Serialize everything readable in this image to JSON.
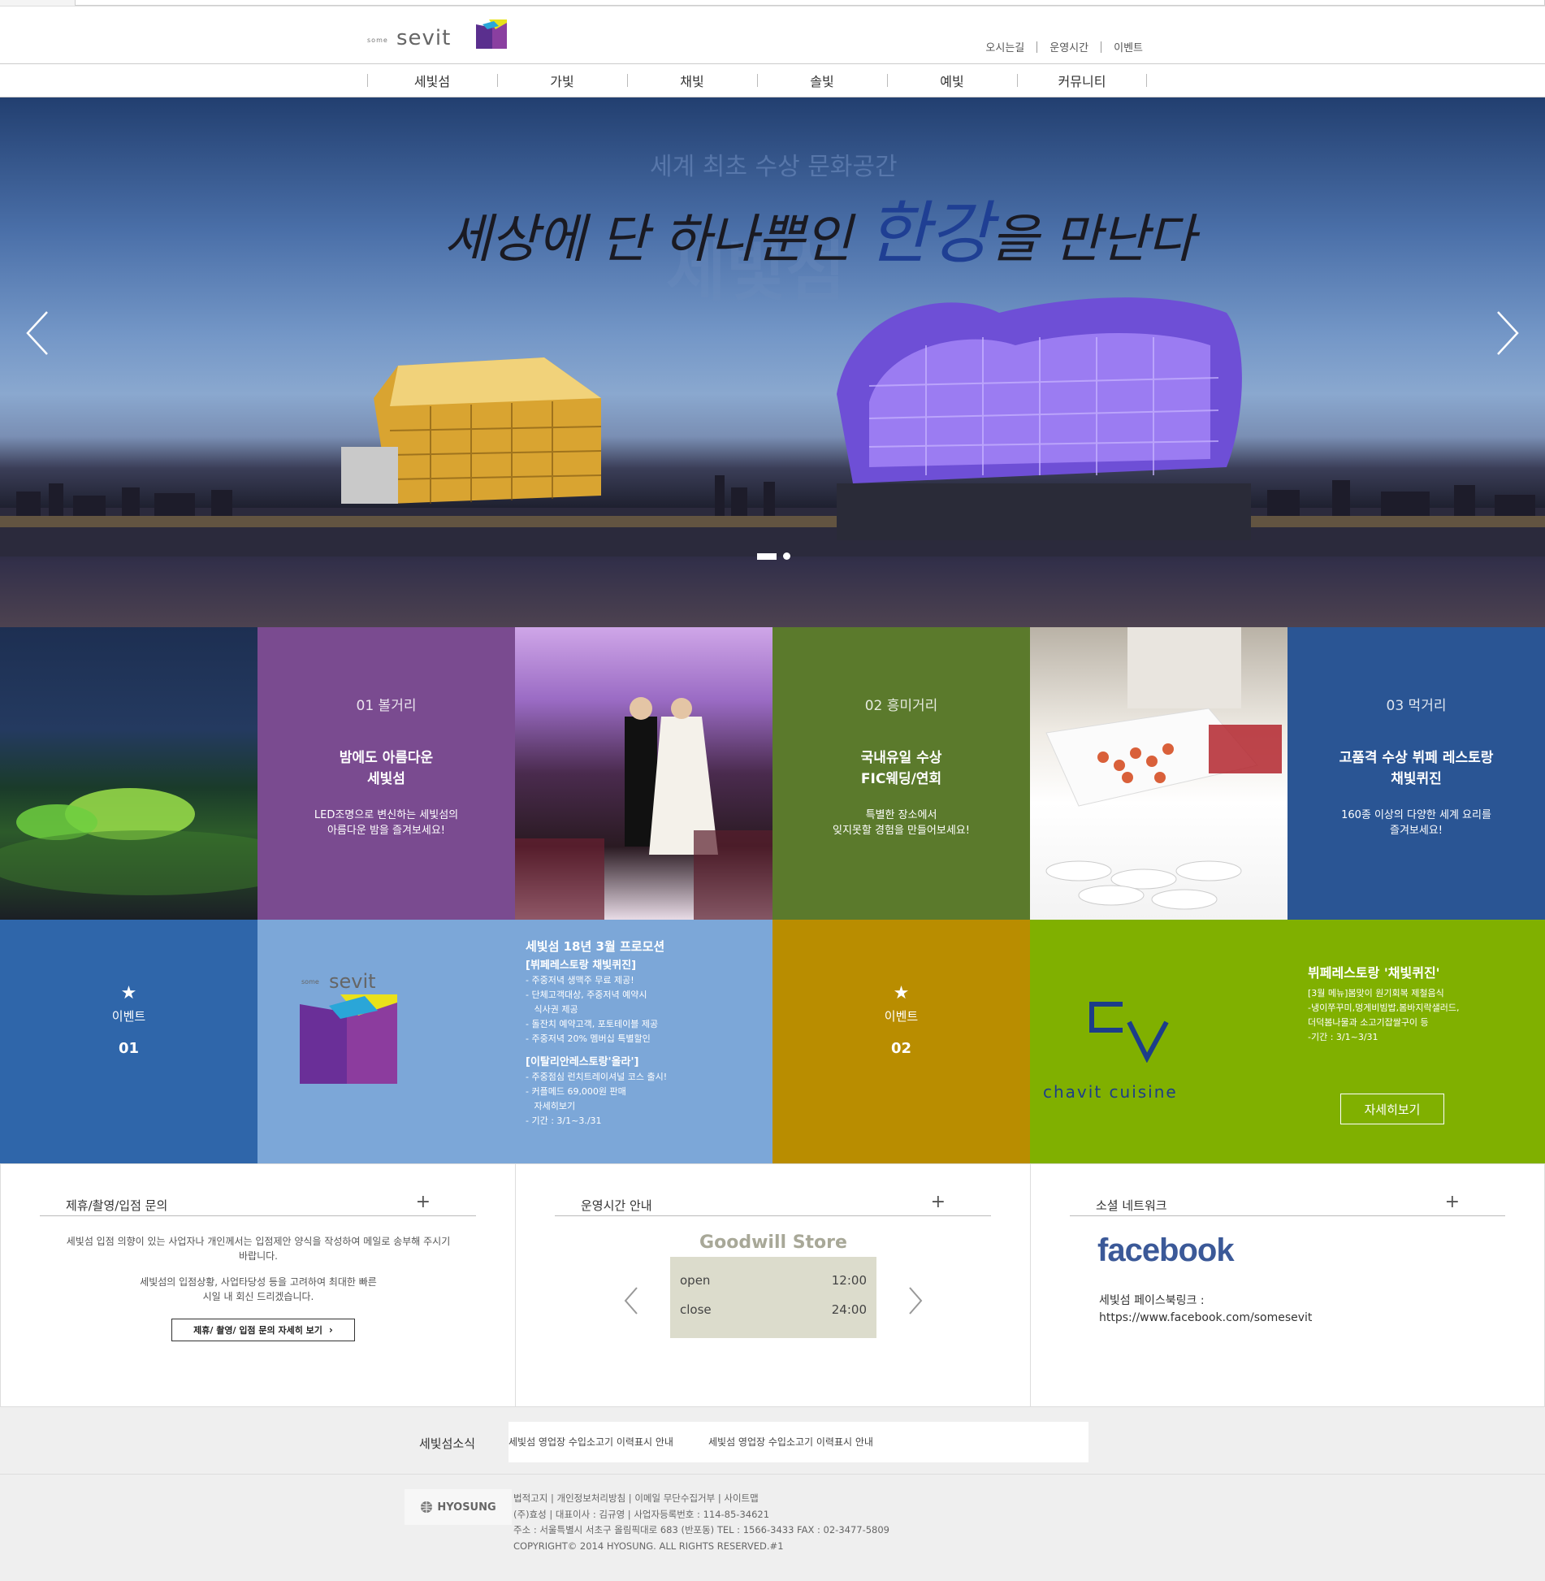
{
  "header": {
    "logo_some": "some",
    "logo_sevit": "sevit",
    "util_links": [
      "오시는길",
      "운영시간",
      "이벤트"
    ]
  },
  "nav": [
    "세빛섬",
    "가빛",
    "채빛",
    "솔빛",
    "예빛",
    "커뮤니티"
  ],
  "hero": {
    "headline_a": "세상에 단 하나뿐인 ",
    "headline_hl": "한강",
    "headline_b": "을 만난다",
    "ghost_small": "세계 최초 수상 문화공간",
    "ghost_big": "세빛섬"
  },
  "features": [
    {
      "num": "01 볼거리",
      "title1": "밤에도 아름다운",
      "title2": "세빛섬",
      "desc1": "LED조명으로 변신하는 세빛섬의",
      "desc2": "아름다운 밤을 즐겨보세요!"
    },
    {
      "num": "02 흥미거리",
      "title1": "국내유일 수상",
      "title2": "FIC웨딩/연회",
      "desc1": "특별한 장소에서",
      "desc2": "잊지못할 경험을 만들어보세요!"
    },
    {
      "num": "03 먹거리",
      "title1": "고품격 수상 뷔페 레스토랑",
      "title2": "채빛퀴진",
      "desc1": "160종 이상의 다양한 세계 요리를",
      "desc2": "즐겨보세요!"
    }
  ],
  "events": [
    {
      "star": "★",
      "label": "이벤트",
      "num": "01"
    },
    {
      "star": "★",
      "label": "이벤트",
      "num": "02"
    }
  ],
  "promo1": {
    "title": "세빛섬 18년 3월 프로모션",
    "sub1": "[뷔페레스토랑 채빛퀴진]",
    "lines1": [
      "- 주중저녁 생맥주 무료 제공!",
      "- 단체고객대상, 주중저녁 예약시",
      "   식사권 제공",
      "- 돌잔치 예약고객, 포토테이블 제공",
      "- 주중저녁 20% 멤버십 특별할인"
    ],
    "sub2": "[이탈리안레스토랑'올라']",
    "lines2": [
      "- 주중점심 런치트레이셔널 코스 출시!",
      "- 커플메드 69,000원 판매",
      "   자세히보기",
      "- 기간 : 3/1~3./31"
    ]
  },
  "promo2": {
    "logo_text": "chavit cuisine",
    "title": "뷔페레스토랑 '채빛퀴진'",
    "lines": [
      "[3월 메뉴]봄맞이 원기회복 제철음식",
      "-냉이쭈꾸미,멍게비빔밥,봄바지락샐러드,",
      "더덕봄나물과 소고기잡쌀구이 등",
      "-기간 : 3/1~3/31"
    ],
    "button": "자세히보기"
  },
  "info": {
    "inquiry": {
      "title": "제휴/촬영/입점 문의",
      "plus": "+",
      "p1a": "세빛섬 입점 의향이 있는 사업자나 개인께서는 입점제안 양식을 작성하여 메일로 송부해 주시기",
      "p1b": "바랍니다.",
      "p2a": "세빛섬의 입점상황, 사업타당성 등을 고려하여 최대한 빠른",
      "p2b": "시일 내 회신 드리겠습니다.",
      "button": "제휴/ 촬영/ 입점 문의 자세히 보기"
    },
    "hours": {
      "title": "운영시간 안내",
      "plus": "+",
      "store": "Goodwill Store",
      "rows": [
        {
          "label": "open",
          "time": "12:00"
        },
        {
          "label": "close",
          "time": "24:00"
        }
      ]
    },
    "social": {
      "title": "소셜 네트워크",
      "plus": "+",
      "brand": "facebook",
      "link_label": "세빛섬 페이스북링크 :",
      "link_url": "https://www.facebook.com/somesevit"
    }
  },
  "news": {
    "label": "세빛섬소식",
    "items": [
      "세빛섬 영업장 수입소고기 이력표시 안내",
      "세빛섬 영업장 수입소고기 이력표시 안내"
    ]
  },
  "footer": {
    "brand": "HYOSUNG",
    "lines": [
      "법적고지 | 개인정보처리방침 | 이메일 무단수집거부 | 사이트맵",
      "(주)효성 | 대표이사 : 김규영 | 사업자등록번호 : 114-85-34621",
      "주소 : 서울특별시 서초구 올림픽대로 683 (반포동) TEL : 1566-3433 FAX : 02-3477-5809",
      "COPYRIGHT© 2014 HYOSUNG. ALL RIGHTS RESERVED.#1"
    ]
  },
  "colors": {
    "purple": "#7a4b90",
    "olive": "#5b7a2c",
    "navy": "#2a5594",
    "blue_event": "#2f66aa",
    "light_blue": "#7ca7d8",
    "gold": "#b98d00",
    "lime": "#80b000",
    "store_bg": "#dcdccc",
    "facebook": "#3b5998"
  }
}
